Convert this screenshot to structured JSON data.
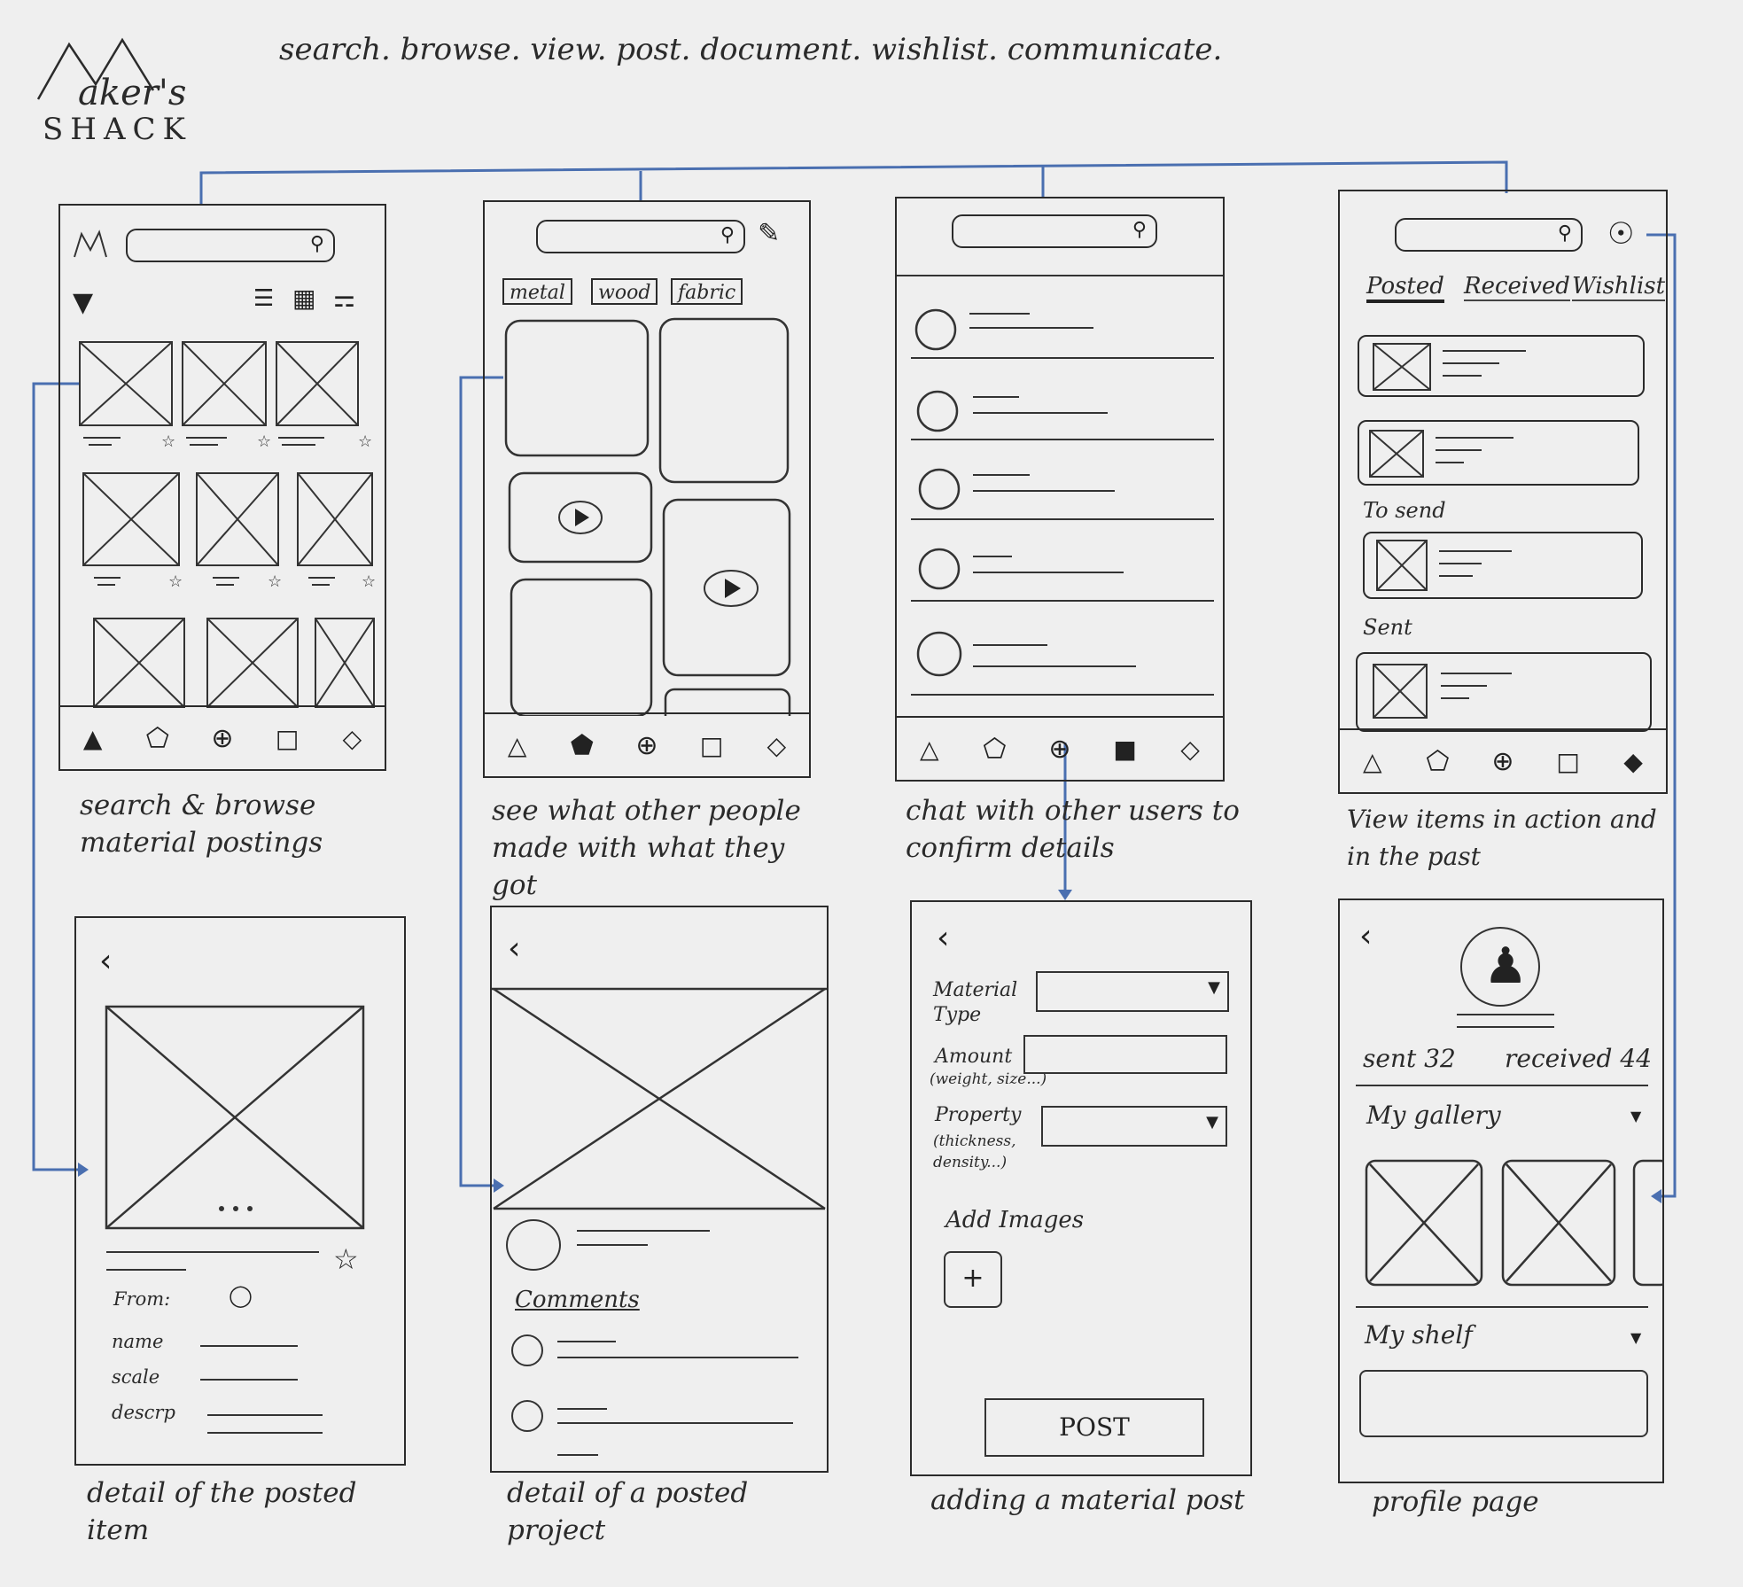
{
  "logo": {
    "text": "aker's",
    "subtitle": "SHACK"
  },
  "header_note": "search. browse. view. post. document. wishlist. communicate.",
  "screens": {
    "browse": {
      "caption": "search & browse material postings"
    },
    "inspiration": {
      "caption": "see what other people made with what they got",
      "chips": [
        "metal",
        "wood",
        "fabric"
      ]
    },
    "chat": {
      "caption": "chat with other users to confirm details"
    },
    "activity": {
      "caption": "View items in action and in the past",
      "tabs": [
        "Posted",
        "Received",
        "Wishlist"
      ],
      "section_to_send": "To send",
      "section_sent": "Sent"
    },
    "item_detail": {
      "caption": "detail of the posted item",
      "from_label": "From:",
      "field_labels": [
        "name",
        "scale",
        "descrp"
      ]
    },
    "project_detail": {
      "caption": "detail of a posted project",
      "comments_label": "Comments"
    },
    "add_post": {
      "caption": "adding a material post",
      "material_type_label": "Material Type",
      "amount_label": "Amount",
      "amount_hint": "(weight, size...)",
      "property_label": "Property",
      "property_hint": "(thickness, density...)",
      "add_images_label": "Add Images",
      "post_button": "POST"
    },
    "profile": {
      "caption": "profile page",
      "sent_label": "sent 32",
      "received_label": "received 44",
      "gallery_label": "My gallery",
      "shelf_label": "My shelf"
    }
  },
  "colors": {
    "connector": "#4a6fb0",
    "ink": "#2b2b2b",
    "paper": "#efefef"
  }
}
